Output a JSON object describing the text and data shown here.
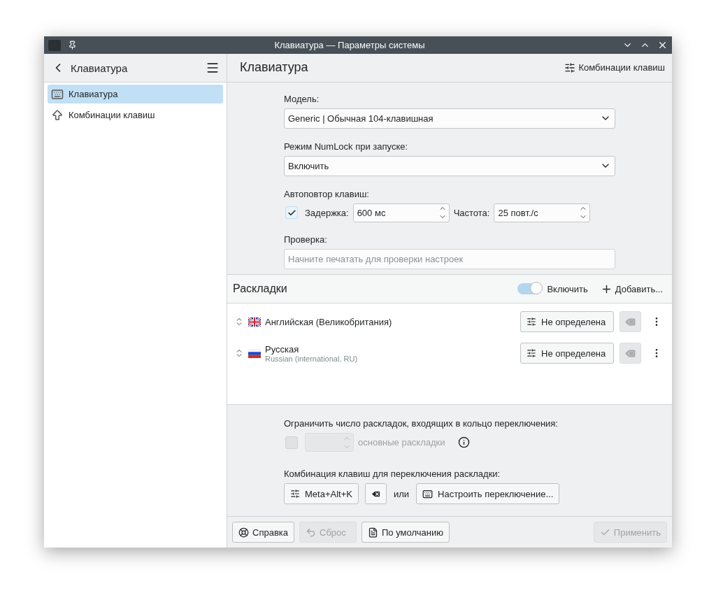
{
  "window": {
    "title": "Клавиатура — Параметры системы"
  },
  "sidebar": {
    "title": "Клавиатура",
    "items": [
      {
        "label": "Клавиатура",
        "selected": true,
        "kind": "keyboard"
      },
      {
        "label": "Комбинации клавиш",
        "selected": false,
        "kind": "shortcuts"
      }
    ]
  },
  "header": {
    "title": "Клавиатура",
    "action": "Комбинации клавиш"
  },
  "form": {
    "model": {
      "label": "Модель:",
      "value": "Generic | Обычная 104-клавишная"
    },
    "numlock": {
      "label": "Режим NumLock при запуске:",
      "value": "Включить"
    },
    "autorepeat": {
      "label": "Автоповтор клавиш:",
      "checked": true,
      "delay_label": "Задержка:",
      "delay_value": "600 мс",
      "rate_label": "Частота:",
      "rate_value": "25 повт./с"
    },
    "test": {
      "label": "Проверка:",
      "placeholder": "Начните печатать для проверки настроек"
    }
  },
  "layouts": {
    "title": "Раскладки",
    "toggle_label": "Включить",
    "toggle_on": true,
    "add_label": "Добавить...",
    "items": [
      {
        "name": "Английская (Великобритания)",
        "kind": "gb",
        "shortcut": "Не определена"
      },
      {
        "name": "Русская",
        "variant": "Russian (international, RU)",
        "kind": "ru",
        "shortcut": "Не определена"
      }
    ]
  },
  "limit": {
    "label": "Ограничить число раскладок, входящих в кольцо переключения:",
    "checked": false,
    "disabled": true,
    "suffix": "основные раскладки"
  },
  "switching": {
    "label": "Комбинация клавиш для переключения раскладки:",
    "shortcut": "Meta+Alt+K",
    "or_label": "или",
    "configure_label": "Настроить переключение..."
  },
  "footer": [
    {
      "label": "Справка",
      "kind": "help",
      "disabled": false
    },
    {
      "label": "Сброс",
      "kind": "reset",
      "disabled": true
    },
    {
      "label": "По умолчанию",
      "kind": "defaults",
      "disabled": false
    },
    {
      "label": "Применить",
      "kind": "apply",
      "disabled": true
    }
  ]
}
